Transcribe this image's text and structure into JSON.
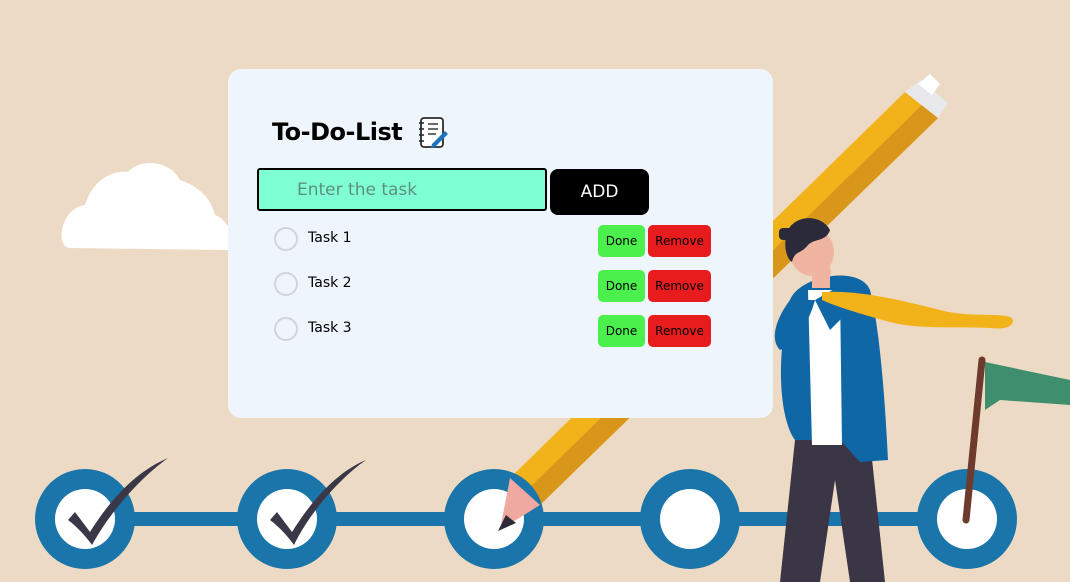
{
  "app": {
    "title": "To-Do-List",
    "title_icon": "notebook-checklist-icon"
  },
  "input": {
    "placeholder": "Enter the task",
    "value": ""
  },
  "add_button": {
    "label": "ADD"
  },
  "tasks": [
    {
      "label": "Task 1",
      "done_label": "Done",
      "remove_label": "Remove",
      "checked": false
    },
    {
      "label": "Task 2",
      "done_label": "Done",
      "remove_label": "Remove",
      "checked": false
    },
    {
      "label": "Task 3",
      "done_label": "Done",
      "remove_label": "Remove",
      "checked": false
    }
  ],
  "colors": {
    "background": "#ecdac4",
    "card": "#eef5fc",
    "input_bg": "#7fffd4",
    "add_button": "#000000",
    "done_button": "#4cf04c",
    "remove_button": "#e81c1c",
    "timeline_blue": "#1a75aa"
  },
  "illustration": {
    "elements": [
      "cloud",
      "giant-pencil",
      "businessman",
      "goal-flag",
      "progress-timeline-checkpoints"
    ],
    "checkpoints_completed": 2,
    "checkpoints_total": 5
  }
}
